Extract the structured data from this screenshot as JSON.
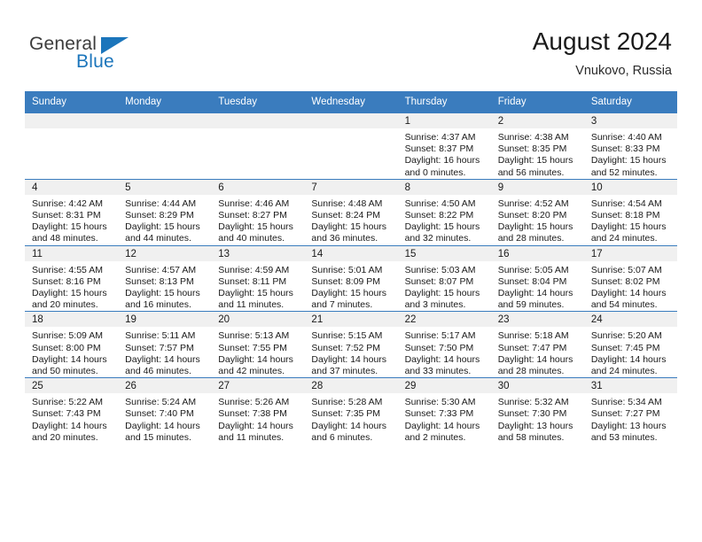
{
  "logo": {
    "word_general": "General",
    "word_blue": "Blue",
    "flag_icon": "triangle-flag-icon"
  },
  "header": {
    "title": "August 2024",
    "subtitle": "Vnukovo, Russia"
  },
  "theme": {
    "accent": "#3a7cbe",
    "logo_blue": "#1b75bb",
    "daynum_band": "#f0f0f0",
    "text": "#1a1a1a"
  },
  "weekday_headers": [
    "Sunday",
    "Monday",
    "Tuesday",
    "Wednesday",
    "Thursday",
    "Friday",
    "Saturday"
  ],
  "weeks": [
    [
      {
        "day": "",
        "sunrise": "",
        "sunset": "",
        "daylight1": "",
        "daylight2": "",
        "empty": true
      },
      {
        "day": "",
        "sunrise": "",
        "sunset": "",
        "daylight1": "",
        "daylight2": "",
        "empty": true
      },
      {
        "day": "",
        "sunrise": "",
        "sunset": "",
        "daylight1": "",
        "daylight2": "",
        "empty": true
      },
      {
        "day": "",
        "sunrise": "",
        "sunset": "",
        "daylight1": "",
        "daylight2": "",
        "empty": true
      },
      {
        "day": "1",
        "sunrise": "Sunrise: 4:37 AM",
        "sunset": "Sunset: 8:37 PM",
        "daylight1": "Daylight: 16 hours",
        "daylight2": "and 0 minutes."
      },
      {
        "day": "2",
        "sunrise": "Sunrise: 4:38 AM",
        "sunset": "Sunset: 8:35 PM",
        "daylight1": "Daylight: 15 hours",
        "daylight2": "and 56 minutes."
      },
      {
        "day": "3",
        "sunrise": "Sunrise: 4:40 AM",
        "sunset": "Sunset: 8:33 PM",
        "daylight1": "Daylight: 15 hours",
        "daylight2": "and 52 minutes."
      }
    ],
    [
      {
        "day": "4",
        "sunrise": "Sunrise: 4:42 AM",
        "sunset": "Sunset: 8:31 PM",
        "daylight1": "Daylight: 15 hours",
        "daylight2": "and 48 minutes."
      },
      {
        "day": "5",
        "sunrise": "Sunrise: 4:44 AM",
        "sunset": "Sunset: 8:29 PM",
        "daylight1": "Daylight: 15 hours",
        "daylight2": "and 44 minutes."
      },
      {
        "day": "6",
        "sunrise": "Sunrise: 4:46 AM",
        "sunset": "Sunset: 8:27 PM",
        "daylight1": "Daylight: 15 hours",
        "daylight2": "and 40 minutes."
      },
      {
        "day": "7",
        "sunrise": "Sunrise: 4:48 AM",
        "sunset": "Sunset: 8:24 PM",
        "daylight1": "Daylight: 15 hours",
        "daylight2": "and 36 minutes."
      },
      {
        "day": "8",
        "sunrise": "Sunrise: 4:50 AM",
        "sunset": "Sunset: 8:22 PM",
        "daylight1": "Daylight: 15 hours",
        "daylight2": "and 32 minutes."
      },
      {
        "day": "9",
        "sunrise": "Sunrise: 4:52 AM",
        "sunset": "Sunset: 8:20 PM",
        "daylight1": "Daylight: 15 hours",
        "daylight2": "and 28 minutes."
      },
      {
        "day": "10",
        "sunrise": "Sunrise: 4:54 AM",
        "sunset": "Sunset: 8:18 PM",
        "daylight1": "Daylight: 15 hours",
        "daylight2": "and 24 minutes."
      }
    ],
    [
      {
        "day": "11",
        "sunrise": "Sunrise: 4:55 AM",
        "sunset": "Sunset: 8:16 PM",
        "daylight1": "Daylight: 15 hours",
        "daylight2": "and 20 minutes."
      },
      {
        "day": "12",
        "sunrise": "Sunrise: 4:57 AM",
        "sunset": "Sunset: 8:13 PM",
        "daylight1": "Daylight: 15 hours",
        "daylight2": "and 16 minutes."
      },
      {
        "day": "13",
        "sunrise": "Sunrise: 4:59 AM",
        "sunset": "Sunset: 8:11 PM",
        "daylight1": "Daylight: 15 hours",
        "daylight2": "and 11 minutes."
      },
      {
        "day": "14",
        "sunrise": "Sunrise: 5:01 AM",
        "sunset": "Sunset: 8:09 PM",
        "daylight1": "Daylight: 15 hours",
        "daylight2": "and 7 minutes."
      },
      {
        "day": "15",
        "sunrise": "Sunrise: 5:03 AM",
        "sunset": "Sunset: 8:07 PM",
        "daylight1": "Daylight: 15 hours",
        "daylight2": "and 3 minutes."
      },
      {
        "day": "16",
        "sunrise": "Sunrise: 5:05 AM",
        "sunset": "Sunset: 8:04 PM",
        "daylight1": "Daylight: 14 hours",
        "daylight2": "and 59 minutes."
      },
      {
        "day": "17",
        "sunrise": "Sunrise: 5:07 AM",
        "sunset": "Sunset: 8:02 PM",
        "daylight1": "Daylight: 14 hours",
        "daylight2": "and 54 minutes."
      }
    ],
    [
      {
        "day": "18",
        "sunrise": "Sunrise: 5:09 AM",
        "sunset": "Sunset: 8:00 PM",
        "daylight1": "Daylight: 14 hours",
        "daylight2": "and 50 minutes."
      },
      {
        "day": "19",
        "sunrise": "Sunrise: 5:11 AM",
        "sunset": "Sunset: 7:57 PM",
        "daylight1": "Daylight: 14 hours",
        "daylight2": "and 46 minutes."
      },
      {
        "day": "20",
        "sunrise": "Sunrise: 5:13 AM",
        "sunset": "Sunset: 7:55 PM",
        "daylight1": "Daylight: 14 hours",
        "daylight2": "and 42 minutes."
      },
      {
        "day": "21",
        "sunrise": "Sunrise: 5:15 AM",
        "sunset": "Sunset: 7:52 PM",
        "daylight1": "Daylight: 14 hours",
        "daylight2": "and 37 minutes."
      },
      {
        "day": "22",
        "sunrise": "Sunrise: 5:17 AM",
        "sunset": "Sunset: 7:50 PM",
        "daylight1": "Daylight: 14 hours",
        "daylight2": "and 33 minutes."
      },
      {
        "day": "23",
        "sunrise": "Sunrise: 5:18 AM",
        "sunset": "Sunset: 7:47 PM",
        "daylight1": "Daylight: 14 hours",
        "daylight2": "and 28 minutes."
      },
      {
        "day": "24",
        "sunrise": "Sunrise: 5:20 AM",
        "sunset": "Sunset: 7:45 PM",
        "daylight1": "Daylight: 14 hours",
        "daylight2": "and 24 minutes."
      }
    ],
    [
      {
        "day": "25",
        "sunrise": "Sunrise: 5:22 AM",
        "sunset": "Sunset: 7:43 PM",
        "daylight1": "Daylight: 14 hours",
        "daylight2": "and 20 minutes."
      },
      {
        "day": "26",
        "sunrise": "Sunrise: 5:24 AM",
        "sunset": "Sunset: 7:40 PM",
        "daylight1": "Daylight: 14 hours",
        "daylight2": "and 15 minutes."
      },
      {
        "day": "27",
        "sunrise": "Sunrise: 5:26 AM",
        "sunset": "Sunset: 7:38 PM",
        "daylight1": "Daylight: 14 hours",
        "daylight2": "and 11 minutes."
      },
      {
        "day": "28",
        "sunrise": "Sunrise: 5:28 AM",
        "sunset": "Sunset: 7:35 PM",
        "daylight1": "Daylight: 14 hours",
        "daylight2": "and 6 minutes."
      },
      {
        "day": "29",
        "sunrise": "Sunrise: 5:30 AM",
        "sunset": "Sunset: 7:33 PM",
        "daylight1": "Daylight: 14 hours",
        "daylight2": "and 2 minutes."
      },
      {
        "day": "30",
        "sunrise": "Sunrise: 5:32 AM",
        "sunset": "Sunset: 7:30 PM",
        "daylight1": "Daylight: 13 hours",
        "daylight2": "and 58 minutes."
      },
      {
        "day": "31",
        "sunrise": "Sunrise: 5:34 AM",
        "sunset": "Sunset: 7:27 PM",
        "daylight1": "Daylight: 13 hours",
        "daylight2": "and 53 minutes."
      }
    ]
  ]
}
